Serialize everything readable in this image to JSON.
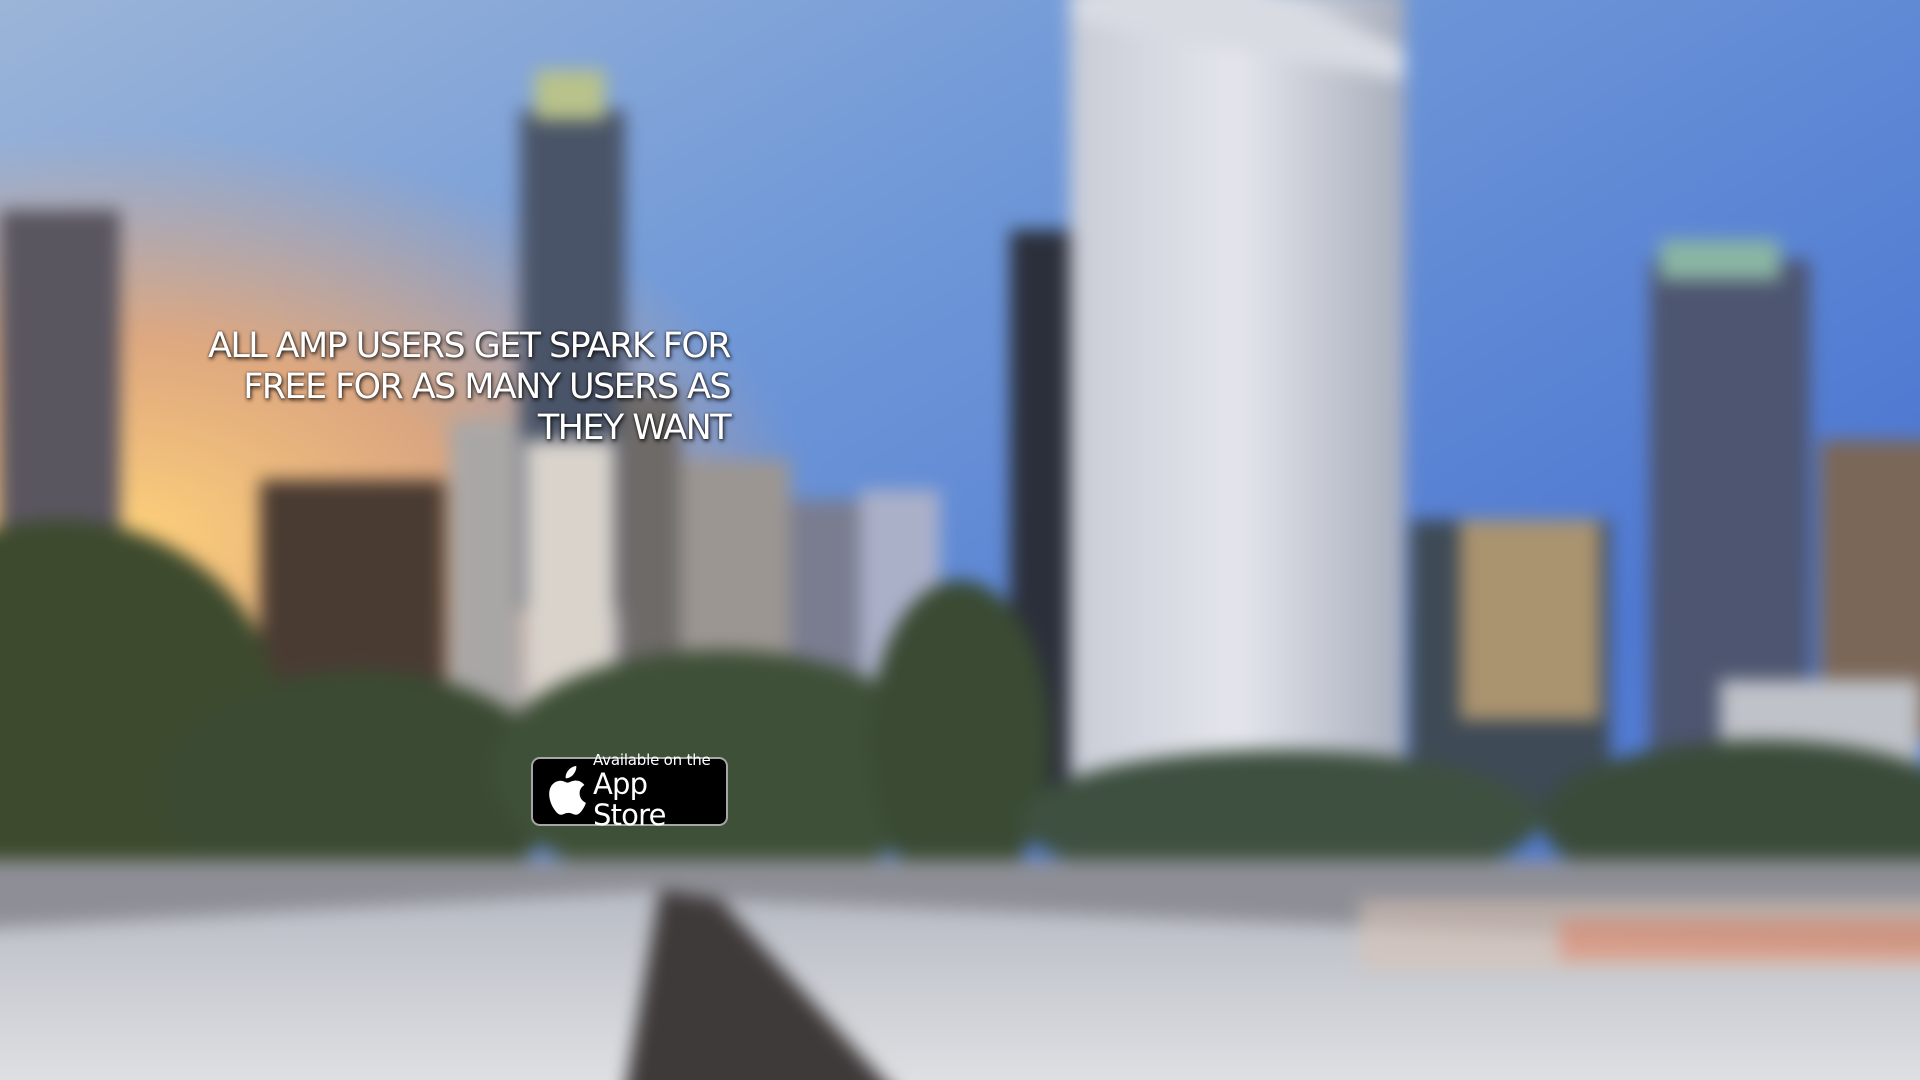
{
  "hero": {
    "background_image": "blurred-city-skyline",
    "headline_lines": [
      "ALL AMP USERS GET SPARK FOR",
      "FREE FOR AS MANY USERS AS",
      "THEY WANT"
    ]
  },
  "app_store_badge": {
    "icon": "apple-icon",
    "small_text": "Available on the",
    "large_text": "App Store"
  }
}
